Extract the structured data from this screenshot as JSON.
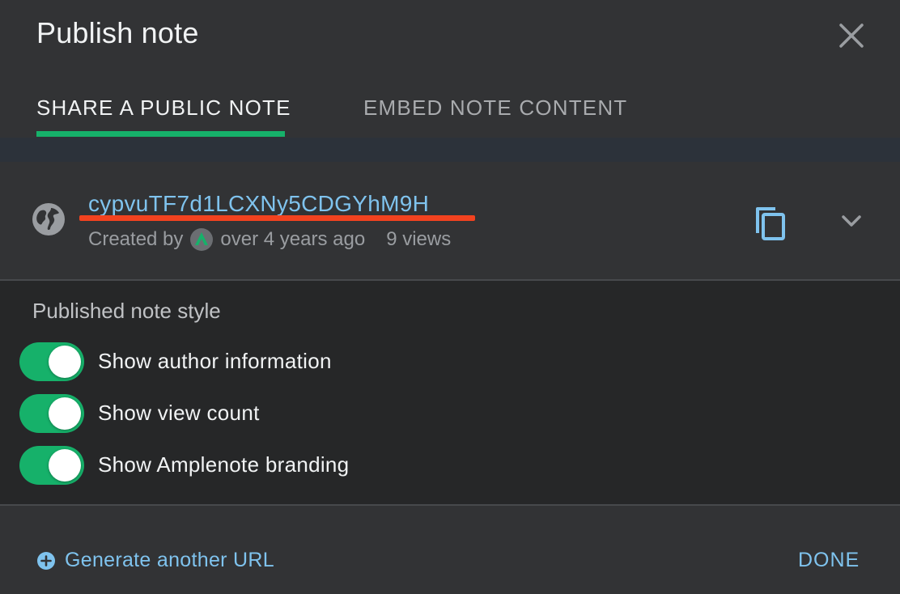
{
  "dialog": {
    "title": "Publish note"
  },
  "tabs": [
    {
      "label": "SHARE A PUBLIC NOTE",
      "active": true
    },
    {
      "label": "EMBED NOTE CONTENT",
      "active": false
    }
  ],
  "published_url": {
    "link_text": "cypvuTF7d1LCXNy5CDGYhM9H",
    "created_by_label": "Created by",
    "created_ago": "over 4 years ago",
    "views": "9 views"
  },
  "style_section": {
    "heading": "Published note style",
    "toggles": [
      {
        "label": "Show author information",
        "on": true
      },
      {
        "label": "Show view count",
        "on": true
      },
      {
        "label": "Show Amplenote branding",
        "on": true
      }
    ]
  },
  "footer": {
    "generate_label": "Generate another URL",
    "done_label": "DONE"
  },
  "icons": {
    "close": "close-icon",
    "globe": "globe-icon",
    "avatar": "amplenote-avatar-icon",
    "copy": "copy-icon",
    "chevron": "chevron-down-icon",
    "add": "plus-circle-icon"
  },
  "colors": {
    "accent_green": "#16b16a",
    "link_blue": "#7fc3ee",
    "redaction_red": "#f2421f"
  }
}
